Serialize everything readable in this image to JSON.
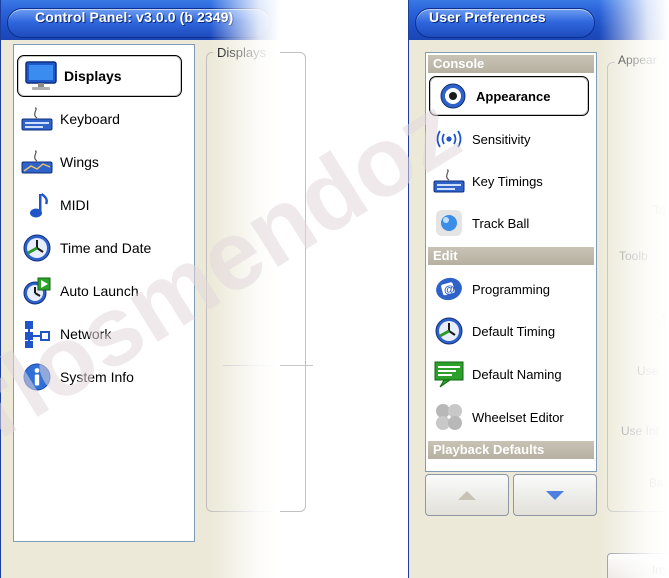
{
  "left_window": {
    "title": "Control Panel: v3.0.0 (b 2349)",
    "group_label": "Displays",
    "items": [
      {
        "label": "Displays",
        "icon": "monitor-icon",
        "selected": true
      },
      {
        "label": "Keyboard",
        "icon": "keyboard-icon"
      },
      {
        "label": "Wings",
        "icon": "wings-icon"
      },
      {
        "label": "MIDI",
        "icon": "music-note-icon"
      },
      {
        "label": "Time and Date",
        "icon": "clock-icon"
      },
      {
        "label": "Auto Launch",
        "icon": "auto-launch-icon"
      },
      {
        "label": "Network",
        "icon": "network-icon"
      },
      {
        "label": "System Info",
        "icon": "info-icon"
      }
    ]
  },
  "right_window": {
    "title": "User Preferences",
    "group_label": "Appear",
    "sections": {
      "console": "Console",
      "edit": "Edit",
      "playback_defaults": "Playback Defaults"
    },
    "items": [
      {
        "label": "Appearance",
        "icon": "appearance-icon",
        "selected": true
      },
      {
        "label": "Sensitivity",
        "icon": "sensitivity-icon"
      },
      {
        "label": "Key Timings",
        "icon": "keyboard-icon"
      },
      {
        "label": "Track Ball",
        "icon": "trackball-icon"
      },
      {
        "label": "Programming",
        "icon": "programming-icon"
      },
      {
        "label": "Default Timing",
        "icon": "clock-icon"
      },
      {
        "label": "Default Naming",
        "icon": "naming-icon"
      },
      {
        "label": "Wheelset Editor",
        "icon": "wheelset-icon"
      }
    ],
    "right_labels": [
      "To",
      "Toolb",
      "S",
      "Use",
      "Use Int",
      "Ba"
    ],
    "import_label": "Imp"
  },
  "watermark": "rlosmendoz",
  "colors": {
    "title_blue": "#1d4fc4",
    "window_bg": "#ece9d8",
    "selected_border": "#000000",
    "section_header": "#b7b0a1"
  }
}
